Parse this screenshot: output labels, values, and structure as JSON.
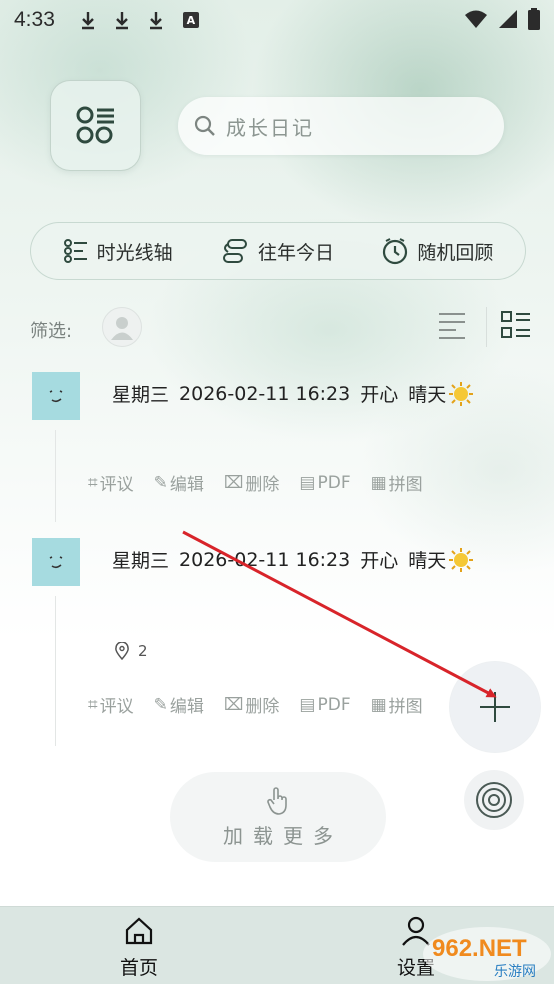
{
  "status_bar": {
    "time": "4:33",
    "download_icons": [
      "download-icon",
      "download-icon",
      "download-icon"
    ],
    "a_badge": "A",
    "right_icons": [
      "wifi-icon",
      "signal-icon",
      "battery-icon"
    ]
  },
  "header": {
    "menu_icon": "menu-grid-icon",
    "search_placeholder": "成长日记"
  },
  "features": [
    {
      "label": "时光线轴",
      "icon": "timeline-icon"
    },
    {
      "label": "往年今日",
      "icon": "history-icon"
    },
    {
      "label": "随机回顾",
      "icon": "clock-icon"
    }
  ],
  "filter": {
    "label": "筛选:",
    "view_modes": [
      "list-view-icon",
      "grid-view-icon"
    ]
  },
  "entries": [
    {
      "weekday": "星期三",
      "datetime": "2026-02-11 16:23",
      "mood": "开心",
      "weather": "晴天",
      "weather_icon": "sun-icon",
      "location_count": null,
      "actions": [
        "评议",
        "编辑",
        "删除",
        "PDF",
        "拼图"
      ]
    },
    {
      "weekday": "星期三",
      "datetime": "2026-02-11 16:23",
      "mood": "开心",
      "weather": "晴天",
      "weather_icon": "sun-icon",
      "location_count": "2",
      "actions": [
        "评议",
        "编辑",
        "删除",
        "PDF",
        "拼图"
      ]
    }
  ],
  "load_more": "加载更多",
  "fab": {
    "add_icon": "plus-icon",
    "scan_icon": "target-icon"
  },
  "bottom_nav": [
    {
      "label": "首页",
      "icon": "home-icon"
    },
    {
      "label": "设置",
      "icon": "user-icon"
    }
  ],
  "watermark": {
    "text": "962.NET",
    "sub": "乐游网"
  },
  "colors": {
    "accent_green": "#2f4a3f",
    "arrow_red": "#d8242a",
    "avatar_bg": "#a6dbe0",
    "nav_bg": "#dbe6e2"
  }
}
